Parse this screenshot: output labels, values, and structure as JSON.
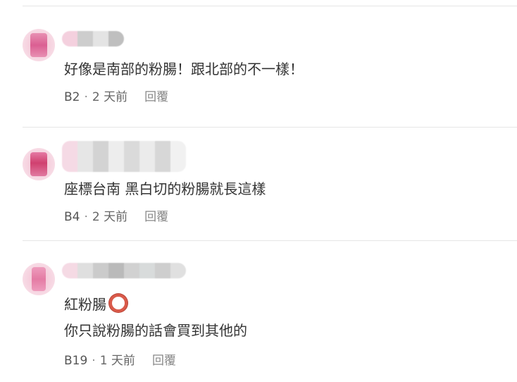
{
  "comments": [
    {
      "text_lines": [
        "好像是南部的粉腸！跟北部的不一樣！"
      ],
      "floor": "B2",
      "time": "2 天前",
      "reply_label": "回覆"
    },
    {
      "text_lines": [
        "座標台南 黑白切的粉腸就長這樣"
      ],
      "floor": "B4",
      "time": "2 天前",
      "reply_label": "回覆"
    },
    {
      "text_lines": [
        "紅粉腸",
        "你只說粉腸的話會買到其他的"
      ],
      "floor": "B19",
      "time": "1 天前",
      "reply_label": "回覆",
      "emoji": "red-circle-ring-emoji"
    }
  ],
  "separator": "·",
  "colors": {
    "text": "#333333",
    "meta": "#666666",
    "divider": "#e6e6e6",
    "emoji_ring": "#d95a4a"
  }
}
